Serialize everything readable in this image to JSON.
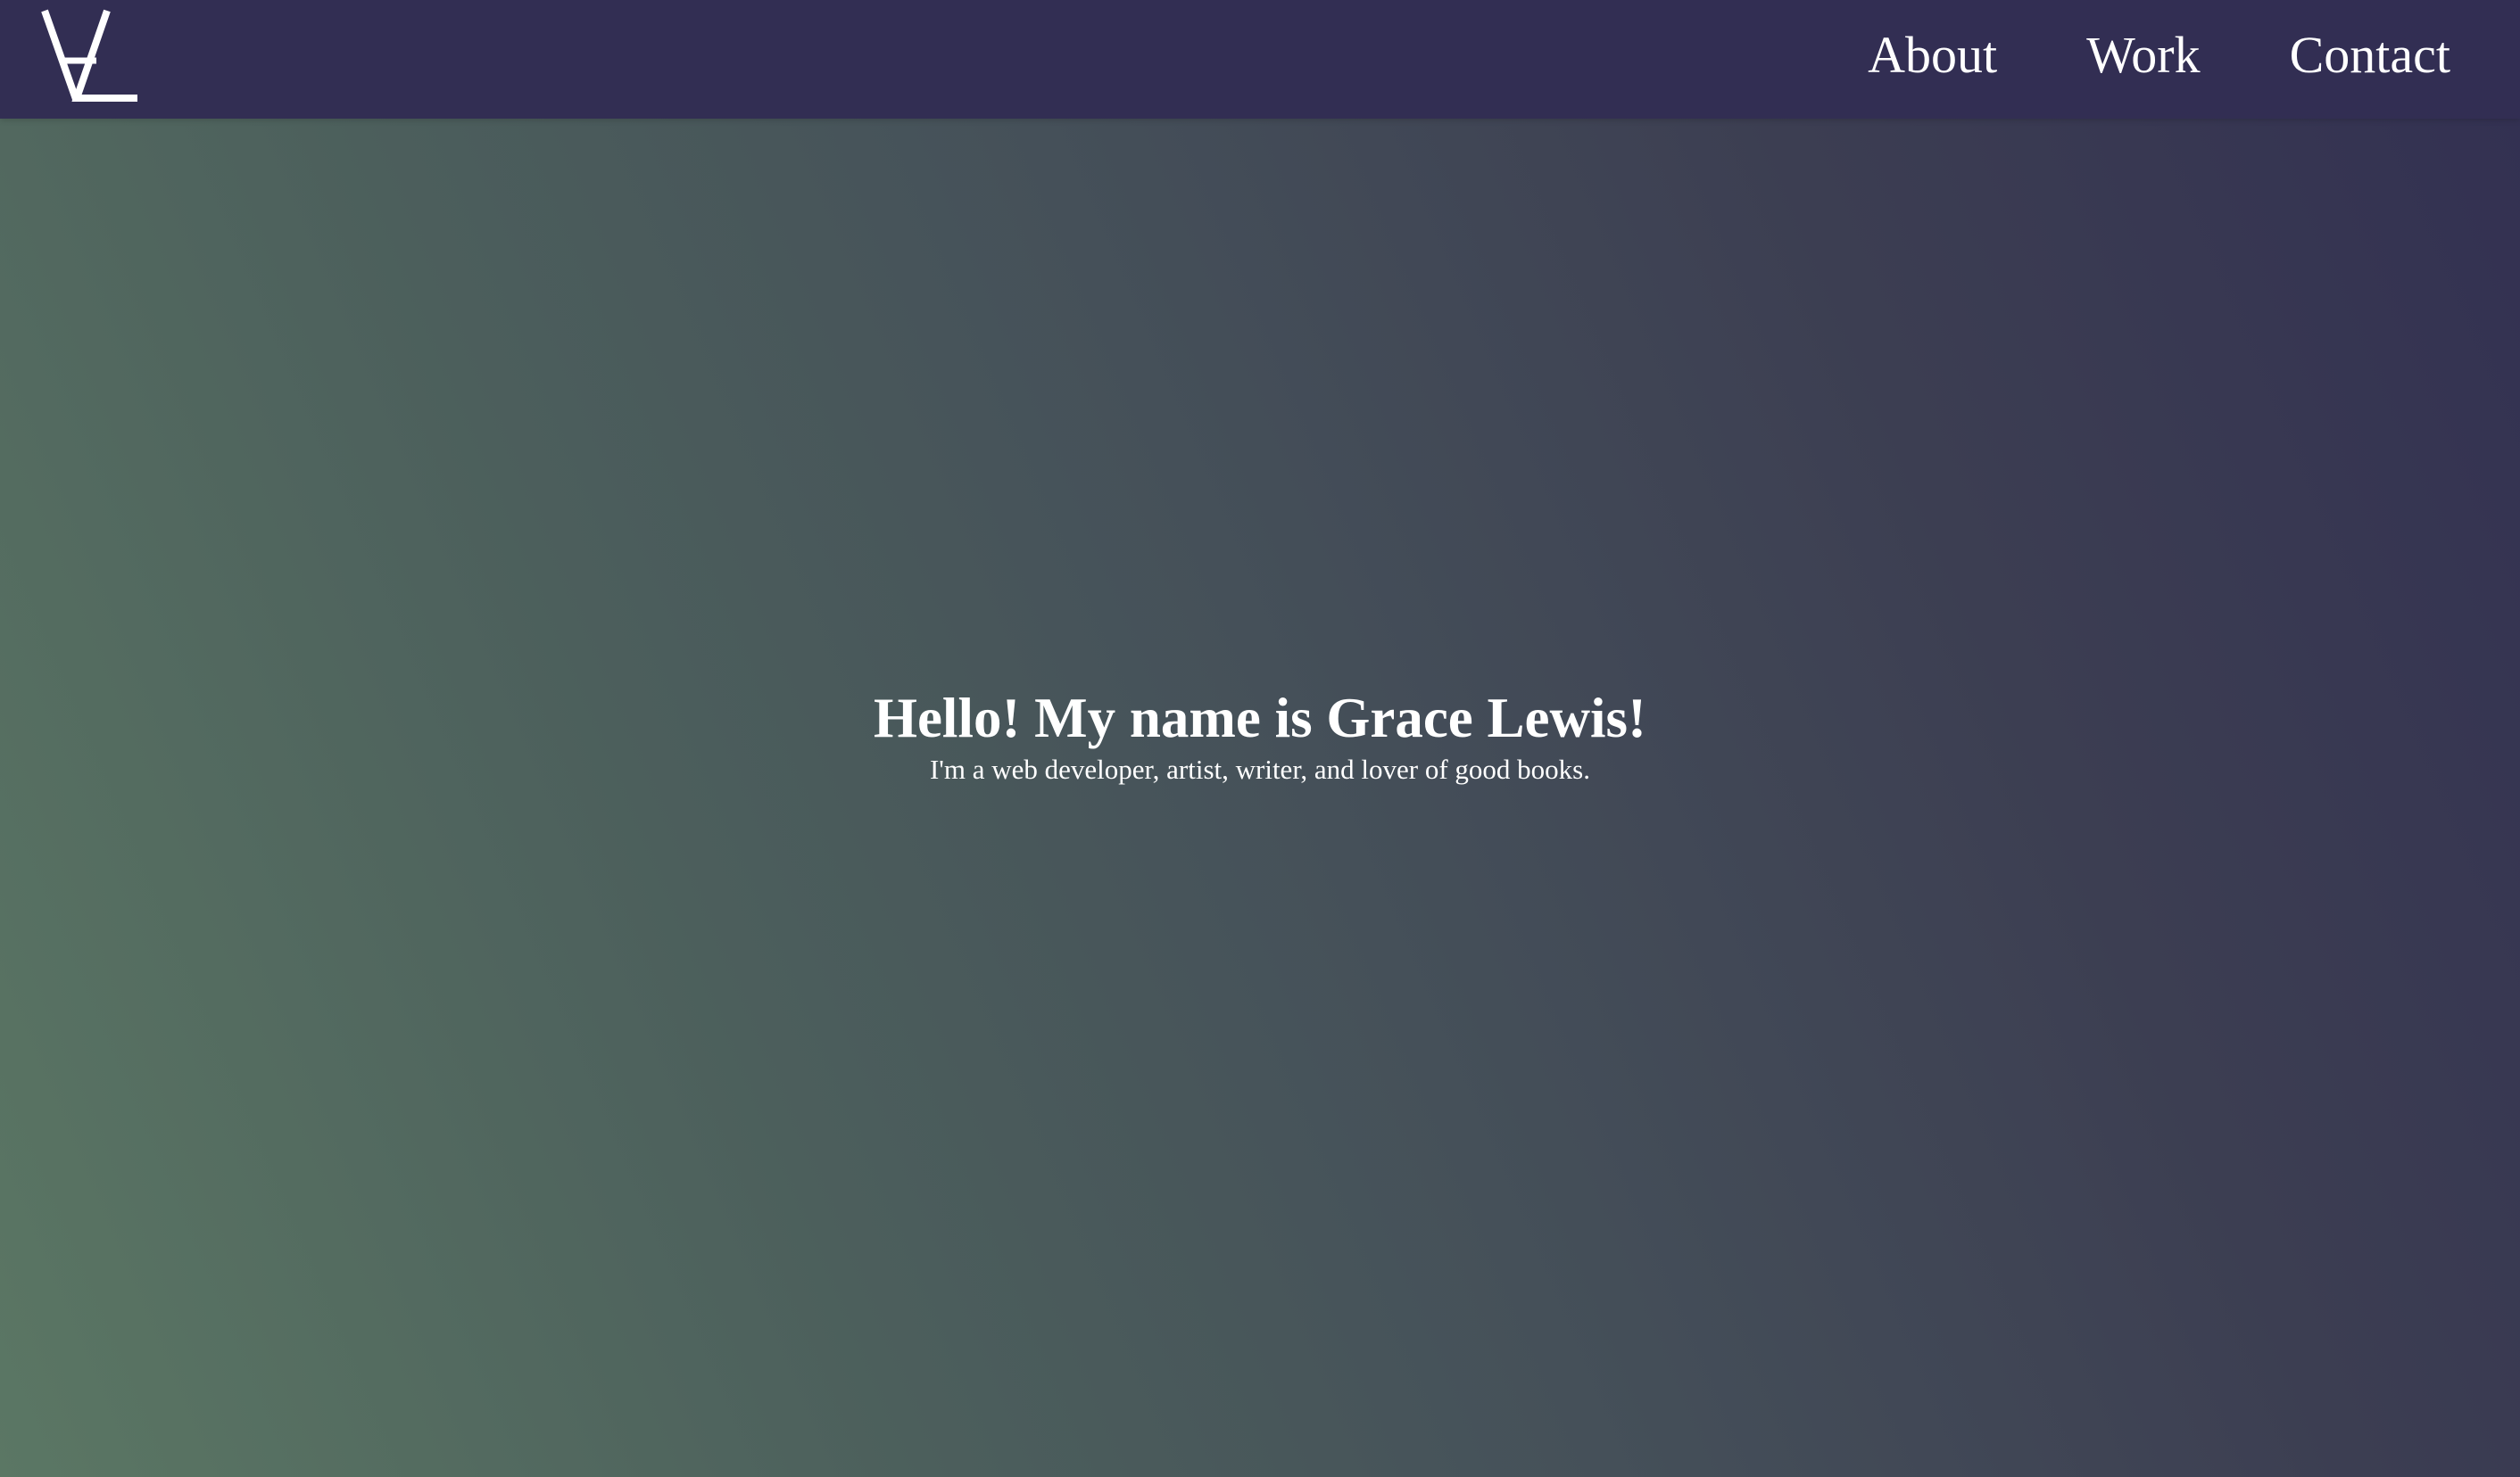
{
  "navbar": {
    "logo": {
      "icon": "gl-monogram-logo",
      "color": "#ffffff"
    },
    "links": [
      {
        "label": "About"
      },
      {
        "label": "Work"
      },
      {
        "label": "Contact"
      }
    ],
    "background": "#322e53"
  },
  "hero": {
    "title": "Hello! My name is Grace Lewis!",
    "subtitle": "I'm a web developer, artist, writer, and lover of good books.",
    "gradient_colors": [
      "#5b7764",
      "#455059",
      "#333152"
    ]
  }
}
